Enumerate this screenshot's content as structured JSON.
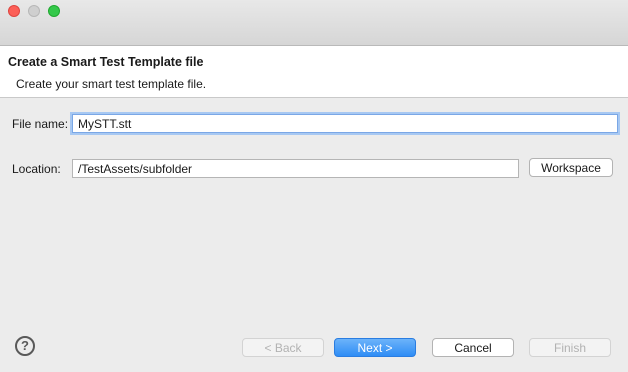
{
  "window": {
    "title_bar": "",
    "controls": [
      "close",
      "minimize",
      "zoom"
    ]
  },
  "banner": {
    "title": "Create a Smart Test Template file",
    "description": "Create your smart test template file."
  },
  "form": {
    "file_name_label": "File name:",
    "file_name_value": "MySTT.stt",
    "location_label": "Location:",
    "location_value": "/TestAssets/subfolder",
    "workspace_button": "Workspace"
  },
  "footer": {
    "help_icon": "question-mark-circle",
    "back_label": "< Back",
    "next_label": "Next >",
    "cancel_label": "Cancel",
    "finish_label": "Finish"
  },
  "colors": {
    "primary_button": "#2f8df5",
    "focus_ring": "#a7c8f2",
    "close": "#fc5f57",
    "zoom": "#34c84a"
  }
}
